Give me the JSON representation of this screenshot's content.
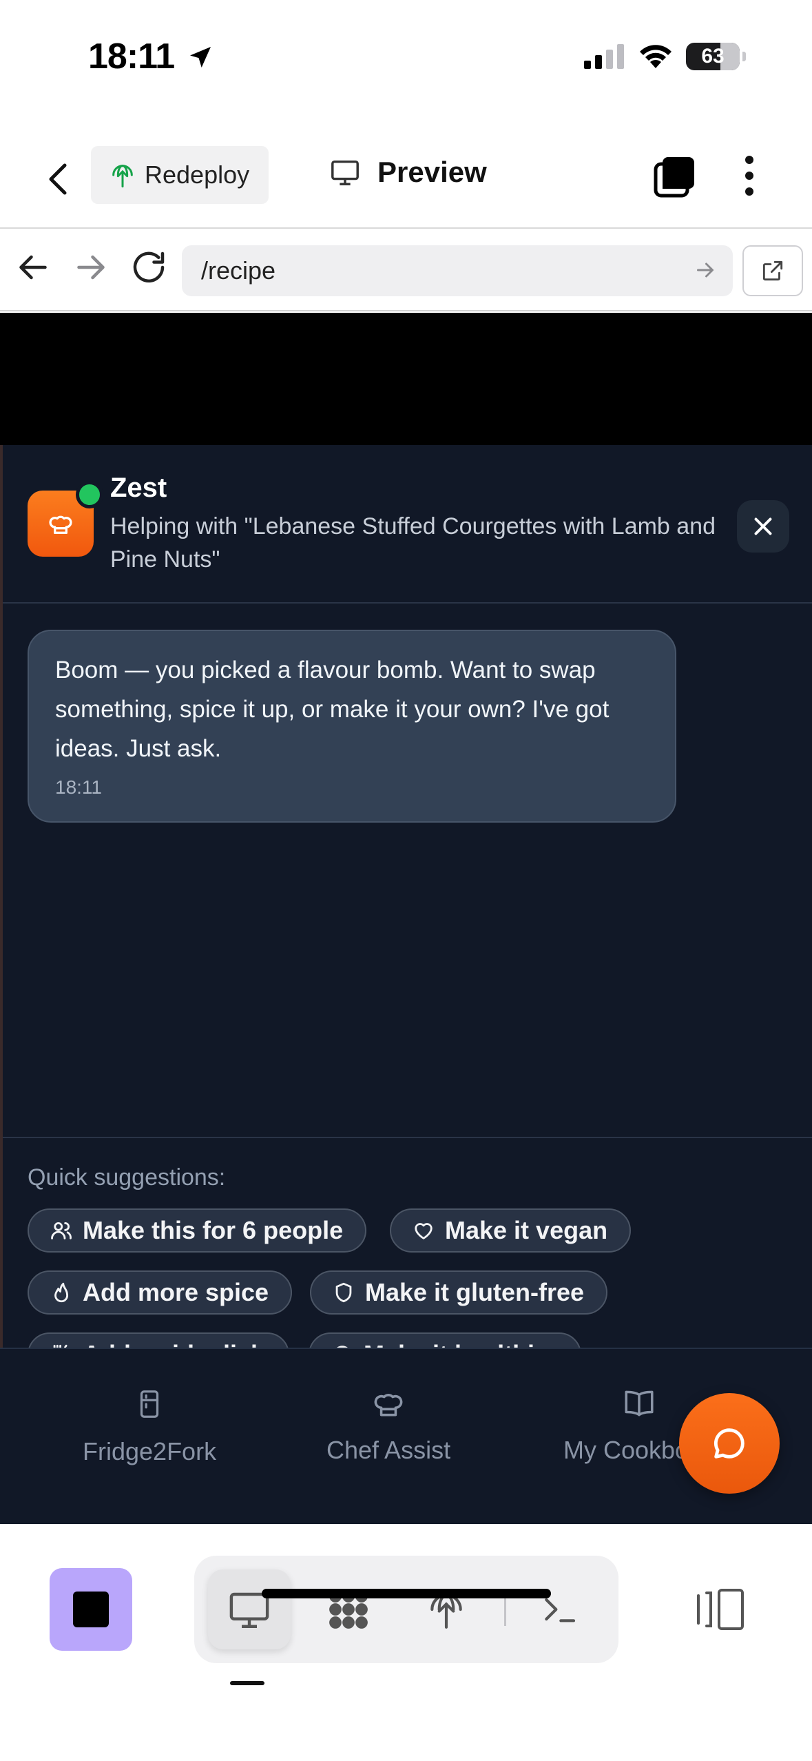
{
  "status_bar": {
    "time": "18:11",
    "battery": "63"
  },
  "header": {
    "redeploy_label": "Redeploy",
    "preview_label": "Preview"
  },
  "url_bar": {
    "path": "/recipe"
  },
  "chat": {
    "bot_name": "Zest",
    "context": "Helping with \"Lebanese Stuffed Courgettes with Lamb and Pine Nuts\"",
    "messages": [
      {
        "text": "Boom — you picked a flavour bomb. Want to swap something, spice it up, or make it your own? I've got ideas. Just ask.",
        "time": "18:11"
      }
    ],
    "suggestions_label": "Quick suggestions:",
    "suggestions": [
      {
        "label": "Make this for 6 people",
        "icon": "users-icon"
      },
      {
        "label": "Make it vegan",
        "icon": "heart-icon"
      },
      {
        "label": "Add more spice",
        "icon": "flame-icon"
      },
      {
        "label": "Make it gluten-free",
        "icon": "shield-icon"
      },
      {
        "label": "Add a side dish",
        "icon": "utensils-icon"
      },
      {
        "label": "Make it healthier",
        "icon": "circle-icon"
      }
    ],
    "accent_color": "#f97316",
    "online_color": "#22c55e"
  },
  "tab_bar": {
    "items": [
      {
        "label": "Fridge2Fork",
        "icon": "fridge-icon"
      },
      {
        "label": "Chef Assist",
        "icon": "chef-hat-icon"
      },
      {
        "label": "My Cookbook",
        "icon": "book-icon"
      }
    ]
  }
}
